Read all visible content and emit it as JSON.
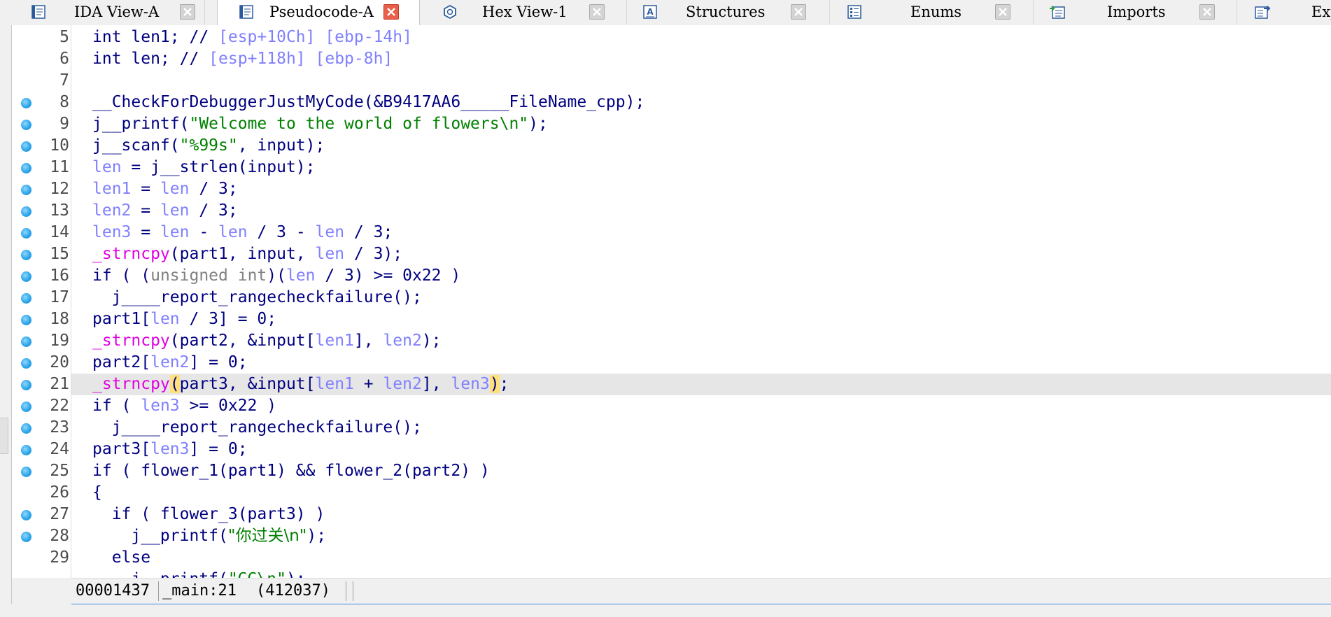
{
  "tabs": [
    {
      "label": "IDA View-A",
      "icon": "disassembly-view-icon",
      "active": false
    },
    {
      "label": "Pseudocode-A",
      "icon": "pseudocode-icon",
      "active": true
    },
    {
      "label": "Hex View-1",
      "icon": "hex-view-icon",
      "active": false
    },
    {
      "label": "Structures",
      "icon": "structures-icon",
      "active": false
    },
    {
      "label": "Enums",
      "icon": "enums-icon",
      "active": false
    },
    {
      "label": "Imports",
      "icon": "imports-icon",
      "active": false
    },
    {
      "label": "Exp",
      "icon": "exports-icon",
      "active": false
    }
  ],
  "code": {
    "current_line": 21,
    "lines": [
      {
        "n": "5",
        "bp": false
      },
      {
        "n": "6",
        "bp": false
      },
      {
        "n": "7",
        "bp": false
      },
      {
        "n": "8",
        "bp": true
      },
      {
        "n": "9",
        "bp": true
      },
      {
        "n": "10",
        "bp": true
      },
      {
        "n": "11",
        "bp": true
      },
      {
        "n": "12",
        "bp": true
      },
      {
        "n": "13",
        "bp": true
      },
      {
        "n": "14",
        "bp": true
      },
      {
        "n": "15",
        "bp": true
      },
      {
        "n": "16",
        "bp": true
      },
      {
        "n": "17",
        "bp": true
      },
      {
        "n": "18",
        "bp": true
      },
      {
        "n": "19",
        "bp": true
      },
      {
        "n": "20",
        "bp": true
      },
      {
        "n": "21",
        "bp": true
      },
      {
        "n": "22",
        "bp": true
      },
      {
        "n": "23",
        "bp": true
      },
      {
        "n": "24",
        "bp": true
      },
      {
        "n": "25",
        "bp": true
      },
      {
        "n": "26",
        "bp": false
      },
      {
        "n": "27",
        "bp": true
      },
      {
        "n": "28",
        "bp": true
      },
      {
        "n": "29",
        "bp": false
      }
    ],
    "tokens": {
      "l5": [
        "int len1; //",
        " [esp+10Ch] [ebp-14h]"
      ],
      "l6": [
        "int len; //",
        " [esp+118h] [ebp-8h]"
      ],
      "l8": "__CheckForDebuggerJustMyCode(&B9417AA6_____FileName_cpp);",
      "l9": [
        "j__printf(",
        "\"Welcome to the world of flowers\\n\"",
        ");"
      ],
      "l10": [
        "j__scanf(",
        "\"%99s\"",
        ", input);"
      ],
      "l11": [
        "len",
        " = j__strlen(input);"
      ],
      "l12": [
        "len1",
        " = ",
        "len",
        " / 3;"
      ],
      "l13": [
        "len2",
        " = ",
        "len",
        " / 3;"
      ],
      "l14": [
        "len3",
        " = ",
        "len",
        " - ",
        "len",
        " / 3 - ",
        "len",
        " / 3;"
      ],
      "l15": [
        "_strncpy",
        "(part1, input, ",
        "len",
        " / 3);"
      ],
      "l16": [
        "if ( (",
        "unsigned int",
        ")(",
        "len",
        " / 3) >= 0x22 )"
      ],
      "l17": "  j____report_rangecheckfailure();",
      "l18": [
        "part1[",
        "len",
        " / 3] = 0;"
      ],
      "l19": [
        "_strncpy",
        "(part2, &input[",
        "len1",
        "], ",
        "len2",
        ");"
      ],
      "l20": [
        "part2[",
        "len2",
        "] = 0;"
      ],
      "l21": [
        "_strncpy",
        "(",
        "part3, &input[",
        "len1",
        " + ",
        "len2",
        "], ",
        "len3",
        ")",
        ";"
      ],
      "l22": [
        "if ( ",
        "len3",
        " >= 0x22 )"
      ],
      "l23": "  j____report_rangecheckfailure();",
      "l24": [
        "part3[",
        "len3",
        "] = 0;"
      ],
      "l25": "if ( flower_1(part1) && flower_2(part2) )",
      "l26": "{",
      "l27": "  if ( flower_3(part3) )",
      "l28": [
        "    j__printf(",
        "\"你过关\\n\"",
        ");"
      ],
      "l29": "  else",
      "l30": [
        "    j__printf(",
        "\"GG\\n\"",
        ");"
      ]
    }
  },
  "status": {
    "address": "00001437",
    "location": "_main:21",
    "offset": "(412037)"
  },
  "colors": {
    "keyword": "#000080",
    "variable": "#8080ff",
    "string": "#008000",
    "library_function": "#e000e0",
    "breakpoint": "#2ea6ea"
  }
}
